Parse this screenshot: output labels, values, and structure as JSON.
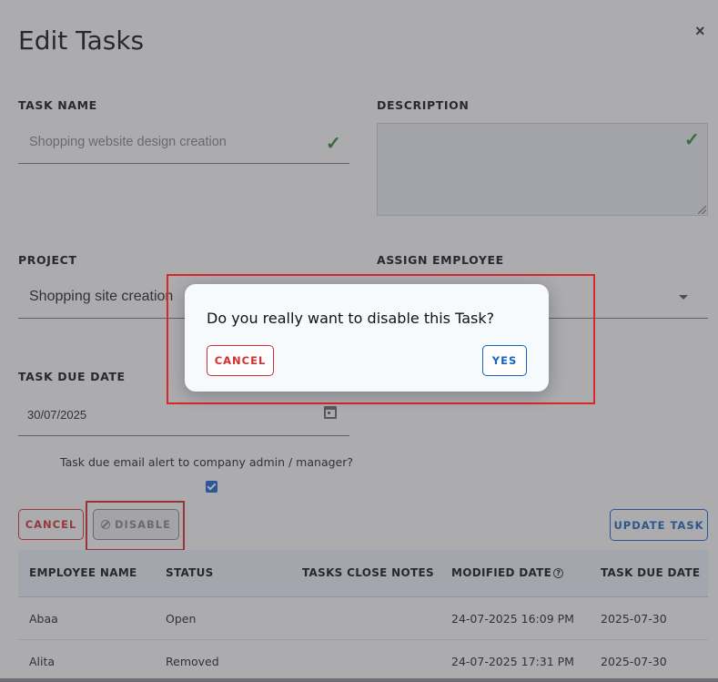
{
  "modal": {
    "title": "Edit Tasks",
    "close_label": "×"
  },
  "form": {
    "task_name": {
      "label": "TASK NAME",
      "value": "Shopping website design creation"
    },
    "description": {
      "label": "DESCRIPTION",
      "value": ""
    },
    "project": {
      "label": "PROJECT",
      "value": "Shopping site creation"
    },
    "assign_employee": {
      "label": "ASSIGN EMPLOYEE",
      "value": ""
    },
    "due_date": {
      "label": "TASK DUE DATE",
      "value": "30/07/2025"
    },
    "email_alert": {
      "label": "Task due email alert to company admin / manager?",
      "checked": true
    }
  },
  "actions": {
    "cancel_label": "CANCEL",
    "disable_label": "DISABLE",
    "update_label": "UPDATE TASK"
  },
  "table": {
    "headers": [
      "EMPLOYEE NAME",
      "STATUS",
      "TASKS CLOSE NOTES",
      "MODIFIED DATE",
      "TASK DUE DATE"
    ],
    "rows": [
      [
        "Abaa",
        "Open",
        "",
        "24-07-2025 16:09 PM",
        "2025-07-30"
      ],
      [
        "Alita",
        "Removed",
        "",
        "24-07-2025 17:31 PM",
        "2025-07-30"
      ]
    ]
  },
  "dialog": {
    "question": "Do you really want to disable this Task?",
    "cancel_label": "CANCEL",
    "yes_label": "YES"
  },
  "colors": {
    "danger": "#d32f2f",
    "primary": "#1565c0",
    "success": "#2a8a3a",
    "highlight_frame": "#d8262b"
  },
  "icons": {
    "close": "close-icon",
    "valid": "checkmark-icon",
    "select_caret": "chevron-down-icon",
    "date": "calendar-icon",
    "disable": "ban-icon",
    "modified_date_help": "help-icon"
  }
}
